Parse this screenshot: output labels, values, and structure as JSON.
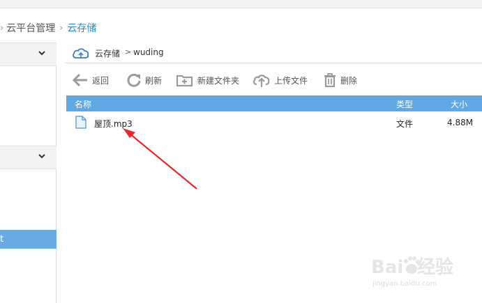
{
  "breadcrumb": {
    "items": [
      {
        "label": "云平台管理"
      },
      {
        "label": "云存储"
      }
    ]
  },
  "sidebar": {
    "selected_item_label": "t",
    "groups": [
      {
        "expanded": true
      },
      {
        "expanded": true
      }
    ]
  },
  "path_bar": {
    "root_label": "云存储",
    "separator": ">",
    "current_folder": "wuding"
  },
  "toolbar": {
    "back_label": "返回",
    "refresh_label": "刷新",
    "new_folder_label": "新建文件夹",
    "upload_label": "上传文件",
    "delete_label": "删除"
  },
  "table": {
    "columns": {
      "name": "名称",
      "type": "类型",
      "size": "大小"
    },
    "rows": [
      {
        "name": "屋顶.mp3",
        "type": "文件",
        "size": "4.88M",
        "icon": "file-icon"
      }
    ]
  },
  "colors": {
    "accent": "#1e8fcf",
    "table_header": "#5fa8e3",
    "sidebar_selected": "#6aaae4",
    "arrow": "#e8282b"
  },
  "watermark": {
    "logo_text": "Baidu经验",
    "url": "jingyan.baidu.com"
  }
}
